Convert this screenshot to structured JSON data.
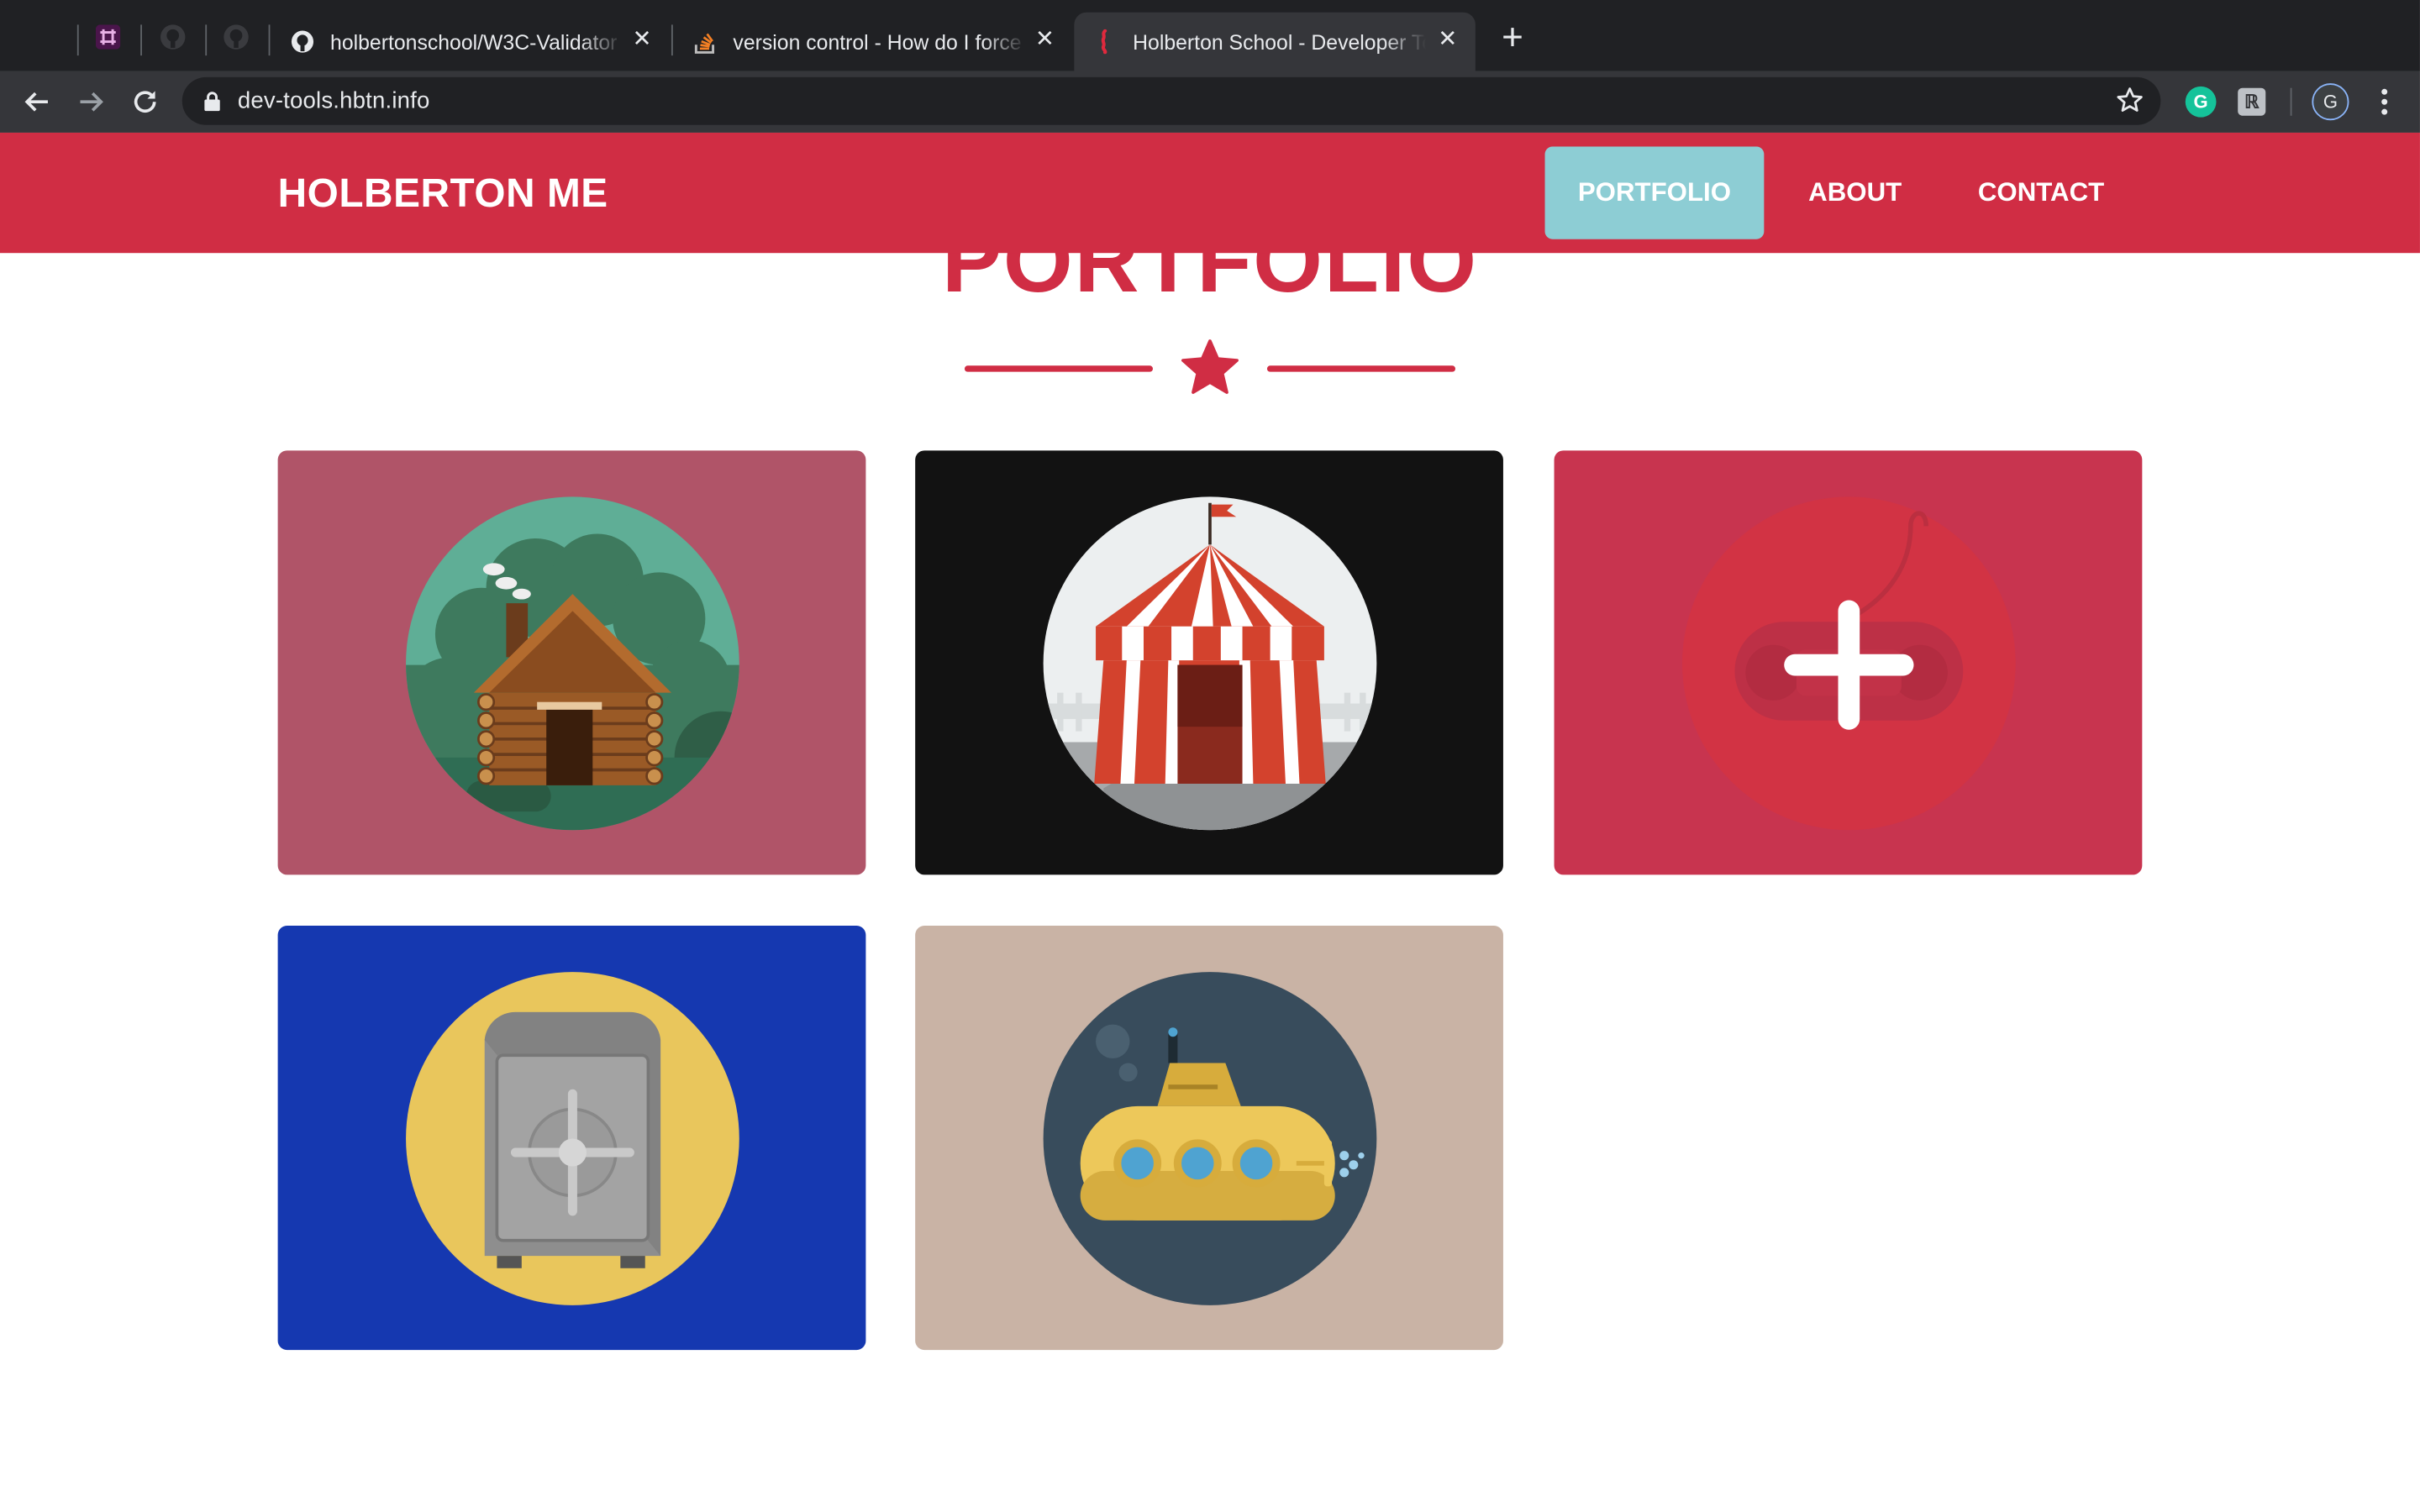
{
  "browser": {
    "tabs": [
      {
        "title": "holbertonschool/W3C-Validator",
        "favicon": "github-icon"
      },
      {
        "title": "version control - How do I force",
        "favicon": "stackoverflow-icon"
      },
      {
        "title": "Holberton School - Developer Tools",
        "favicon": "holberton-icon",
        "active": true
      }
    ],
    "pinned_tabs": [
      "slack-icon",
      "github-icon",
      "github-icon"
    ],
    "url": "dev-tools.hbtn.info",
    "profile_initial": "G",
    "extensions": [
      "grammarly-icon",
      "extension-icon"
    ]
  },
  "site": {
    "brand": "HOLBERTON ME",
    "nav": [
      {
        "label": "PORTFOLIO",
        "active": true
      },
      {
        "label": "ABOUT",
        "active": false
      },
      {
        "label": "CONTACT",
        "active": false
      }
    ],
    "section_title": "PORTFOLIO",
    "portfolio": [
      {
        "name": "cabin",
        "icon": "log-cabin-icon",
        "background": "#b05468"
      },
      {
        "name": "circus",
        "icon": "circus-tent-icon",
        "background": "#121212"
      },
      {
        "name": "game",
        "icon": "gamepad-icon",
        "background": "#c8344f"
      },
      {
        "name": "safe",
        "icon": "safe-icon",
        "background": "#1538b0"
      },
      {
        "name": "submarine",
        "icon": "submarine-icon",
        "background": "#c9b3a5"
      }
    ],
    "colors": {
      "brand": "#d02d44",
      "active_nav": "#8dcdd4"
    }
  }
}
